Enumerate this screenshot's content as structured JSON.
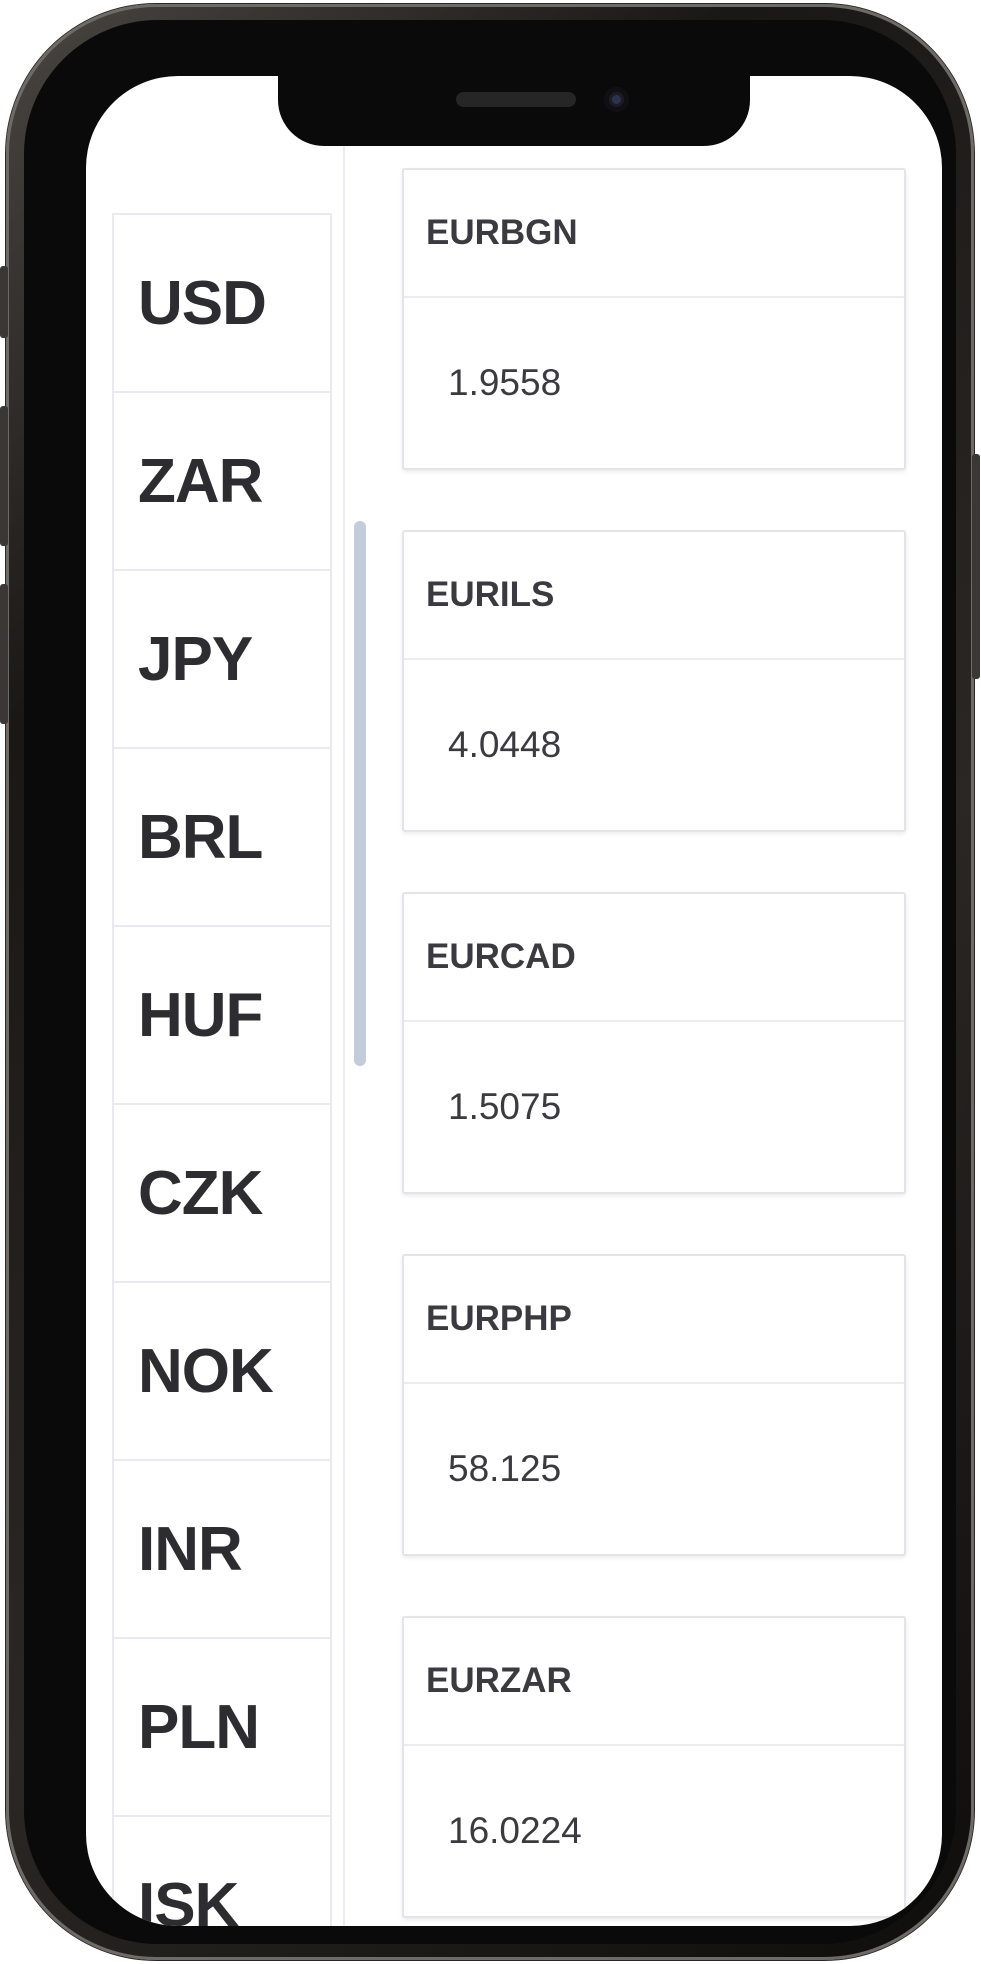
{
  "currencies": [
    {
      "code": "USD"
    },
    {
      "code": "ZAR"
    },
    {
      "code": "JPY"
    },
    {
      "code": "BRL"
    },
    {
      "code": "HUF"
    },
    {
      "code": "CZK"
    },
    {
      "code": "NOK"
    },
    {
      "code": "INR"
    },
    {
      "code": "PLN"
    },
    {
      "code": "ISK"
    }
  ],
  "rates": [
    {
      "pair": "EURBGN",
      "value": "1.9558"
    },
    {
      "pair": "EURILS",
      "value": "4.0448"
    },
    {
      "pair": "EURCAD",
      "value": "1.5075"
    },
    {
      "pair": "EURPHP",
      "value": "58.125"
    },
    {
      "pair": "EURZAR",
      "value": "16.0224"
    }
  ]
}
